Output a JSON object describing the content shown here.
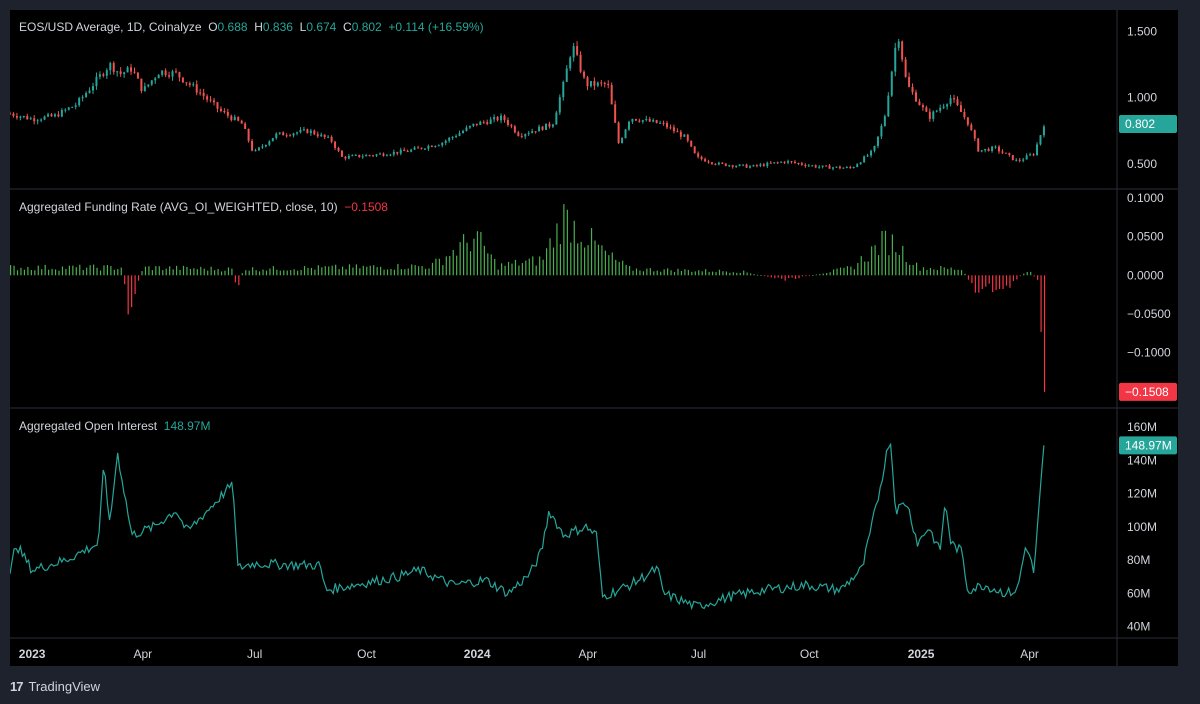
{
  "header": {
    "symbol": "EOS/USD Average, 1D, Coinalyze",
    "o_label": "O",
    "o": "0.688",
    "h_label": "H",
    "h": "0.836",
    "l_label": "L",
    "l": "0.674",
    "c_label": "C",
    "c": "0.802",
    "change": "+0.114 (+16.59%)"
  },
  "funding_header": {
    "title": "Aggregated Funding Rate (AVG_OI_WEIGHTED, close, 10)",
    "value": "−0.1508"
  },
  "oi_header": {
    "title": "Aggregated Open Interest",
    "value": "148.97M"
  },
  "footer": {
    "brand": "TradingView",
    "logo": "17"
  },
  "colors": {
    "up": "#26a69a",
    "down": "#ef5350",
    "funding_up": "#4caf50",
    "funding_down": "#f23645",
    "oi_line": "#26a69a",
    "bg": "#000000",
    "frame": "#1e222d"
  },
  "chart_data": [
    {
      "type": "candlestick",
      "pane": "price",
      "ticks": [
        "1.500",
        "1.000",
        "0.500"
      ],
      "tick_values": [
        1.5,
        1.0,
        0.5
      ],
      "ylim": [
        0.38,
        1.6
      ],
      "last_value_label": "0.802",
      "keypoints": [
        {
          "t": 0.0,
          "v": 0.88
        },
        {
          "t": 0.02,
          "v": 0.84
        },
        {
          "t": 0.04,
          "v": 0.86
        },
        {
          "t": 0.06,
          "v": 0.95
        },
        {
          "t": 0.09,
          "v": 1.25
        },
        {
          "t": 0.1,
          "v": 1.18
        },
        {
          "t": 0.11,
          "v": 1.22
        },
        {
          "t": 0.12,
          "v": 1.05
        },
        {
          "t": 0.135,
          "v": 1.2
        },
        {
          "t": 0.15,
          "v": 1.18
        },
        {
          "t": 0.17,
          "v": 1.05
        },
        {
          "t": 0.19,
          "v": 0.9
        },
        {
          "t": 0.21,
          "v": 0.8
        },
        {
          "t": 0.22,
          "v": 0.58
        },
        {
          "t": 0.24,
          "v": 0.72
        },
        {
          "t": 0.27,
          "v": 0.75
        },
        {
          "t": 0.29,
          "v": 0.68
        },
        {
          "t": 0.3,
          "v": 0.55
        },
        {
          "t": 0.33,
          "v": 0.57
        },
        {
          "t": 0.36,
          "v": 0.6
        },
        {
          "t": 0.39,
          "v": 0.66
        },
        {
          "t": 0.42,
          "v": 0.8
        },
        {
          "t": 0.445,
          "v": 0.85
        },
        {
          "t": 0.46,
          "v": 0.72
        },
        {
          "t": 0.49,
          "v": 0.8
        },
        {
          "t": 0.5,
          "v": 1.1
        },
        {
          "t": 0.508,
          "v": 1.4
        },
        {
          "t": 0.52,
          "v": 1.1
        },
        {
          "t": 0.54,
          "v": 1.1
        },
        {
          "t": 0.55,
          "v": 0.65
        },
        {
          "t": 0.56,
          "v": 0.85
        },
        {
          "t": 0.59,
          "v": 0.8
        },
        {
          "t": 0.61,
          "v": 0.7
        },
        {
          "t": 0.62,
          "v": 0.55
        },
        {
          "t": 0.64,
          "v": 0.5
        },
        {
          "t": 0.67,
          "v": 0.48
        },
        {
          "t": 0.7,
          "v": 0.52
        },
        {
          "t": 0.73,
          "v": 0.48
        },
        {
          "t": 0.76,
          "v": 0.47
        },
        {
          "t": 0.78,
          "v": 0.6
        },
        {
          "t": 0.79,
          "v": 0.85
        },
        {
          "t": 0.802,
          "v": 1.5
        },
        {
          "t": 0.81,
          "v": 1.1
        },
        {
          "t": 0.83,
          "v": 0.85
        },
        {
          "t": 0.85,
          "v": 1.0
        },
        {
          "t": 0.865,
          "v": 0.82
        },
        {
          "t": 0.875,
          "v": 0.6
        },
        {
          "t": 0.89,
          "v": 0.62
        },
        {
          "t": 0.91,
          "v": 0.52
        },
        {
          "t": 0.925,
          "v": 0.58
        },
        {
          "t": 0.93,
          "v": 0.7
        },
        {
          "t": 0.934,
          "v": 0.802
        }
      ]
    },
    {
      "type": "histogram",
      "pane": "funding",
      "ticks": [
        "0.1000",
        "0.0500",
        "0.0000",
        "−0.0500",
        "−0.1000"
      ],
      "tick_values": [
        0.1,
        0.05,
        0.0,
        -0.05,
        -0.1
      ],
      "ylim": [
        -0.16,
        0.1
      ],
      "last_value_label": "−0.1508",
      "keypoints": [
        {
          "t": 0.0,
          "v": 0.01
        },
        {
          "t": 0.1,
          "v": 0.01
        },
        {
          "t": 0.107,
          "v": -0.045
        },
        {
          "t": 0.12,
          "v": 0.01
        },
        {
          "t": 0.2,
          "v": 0.008
        },
        {
          "t": 0.205,
          "v": -0.018
        },
        {
          "t": 0.21,
          "v": 0.008
        },
        {
          "t": 0.38,
          "v": 0.012
        },
        {
          "t": 0.42,
          "v": 0.05
        },
        {
          "t": 0.44,
          "v": 0.012
        },
        {
          "t": 0.48,
          "v": 0.02
        },
        {
          "t": 0.5,
          "v": 0.075
        },
        {
          "t": 0.52,
          "v": 0.05
        },
        {
          "t": 0.54,
          "v": 0.025
        },
        {
          "t": 0.56,
          "v": 0.008
        },
        {
          "t": 0.66,
          "v": 0.005
        },
        {
          "t": 0.7,
          "v": -0.006
        },
        {
          "t": 0.76,
          "v": 0.01
        },
        {
          "t": 0.79,
          "v": 0.045
        },
        {
          "t": 0.8,
          "v": 0.04
        },
        {
          "t": 0.82,
          "v": 0.01
        },
        {
          "t": 0.86,
          "v": 0.008
        },
        {
          "t": 0.87,
          "v": -0.02
        },
        {
          "t": 0.9,
          "v": -0.015
        },
        {
          "t": 0.92,
          "v": 0.008
        },
        {
          "t": 0.928,
          "v": -0.01
        },
        {
          "t": 0.934,
          "v": -0.1508
        }
      ]
    },
    {
      "type": "line",
      "pane": "open_interest",
      "ticks": [
        "160M",
        "140M",
        "120M",
        "100M",
        "80M",
        "60M",
        "40M"
      ],
      "tick_values": [
        160,
        140,
        120,
        100,
        80,
        60,
        40
      ],
      "ylim": [
        38,
        166
      ],
      "unit": "M",
      "last_value_label": "148.97M",
      "keypoints": [
        {
          "t": 0.0,
          "v": 70
        },
        {
          "t": 0.005,
          "v": 90
        },
        {
          "t": 0.02,
          "v": 74
        },
        {
          "t": 0.05,
          "v": 80
        },
        {
          "t": 0.08,
          "v": 90
        },
        {
          "t": 0.085,
          "v": 140
        },
        {
          "t": 0.09,
          "v": 100
        },
        {
          "t": 0.097,
          "v": 145
        },
        {
          "t": 0.11,
          "v": 95
        },
        {
          "t": 0.13,
          "v": 100
        },
        {
          "t": 0.15,
          "v": 110
        },
        {
          "t": 0.16,
          "v": 97
        },
        {
          "t": 0.19,
          "v": 118
        },
        {
          "t": 0.2,
          "v": 125
        },
        {
          "t": 0.203,
          "v": 115
        },
        {
          "t": 0.205,
          "v": 75
        },
        {
          "t": 0.22,
          "v": 78
        },
        {
          "t": 0.26,
          "v": 77
        },
        {
          "t": 0.28,
          "v": 77
        },
        {
          "t": 0.285,
          "v": 62
        },
        {
          "t": 0.31,
          "v": 65
        },
        {
          "t": 0.35,
          "v": 70
        },
        {
          "t": 0.37,
          "v": 74
        },
        {
          "t": 0.4,
          "v": 65
        },
        {
          "t": 0.43,
          "v": 68
        },
        {
          "t": 0.45,
          "v": 60
        },
        {
          "t": 0.47,
          "v": 72
        },
        {
          "t": 0.48,
          "v": 85
        },
        {
          "t": 0.487,
          "v": 110
        },
        {
          "t": 0.5,
          "v": 95
        },
        {
          "t": 0.52,
          "v": 100
        },
        {
          "t": 0.53,
          "v": 95
        },
        {
          "t": 0.535,
          "v": 58
        },
        {
          "t": 0.56,
          "v": 65
        },
        {
          "t": 0.585,
          "v": 75
        },
        {
          "t": 0.59,
          "v": 60
        },
        {
          "t": 0.62,
          "v": 52
        },
        {
          "t": 0.65,
          "v": 58
        },
        {
          "t": 0.68,
          "v": 62
        },
        {
          "t": 0.72,
          "v": 65
        },
        {
          "t": 0.75,
          "v": 62
        },
        {
          "t": 0.77,
          "v": 75
        },
        {
          "t": 0.785,
          "v": 120
        },
        {
          "t": 0.795,
          "v": 155
        },
        {
          "t": 0.8,
          "v": 110
        },
        {
          "t": 0.81,
          "v": 115
        },
        {
          "t": 0.82,
          "v": 90
        },
        {
          "t": 0.83,
          "v": 100
        },
        {
          "t": 0.84,
          "v": 85
        },
        {
          "t": 0.845,
          "v": 115
        },
        {
          "t": 0.85,
          "v": 90
        },
        {
          "t": 0.86,
          "v": 85
        },
        {
          "t": 0.865,
          "v": 62
        },
        {
          "t": 0.88,
          "v": 65
        },
        {
          "t": 0.9,
          "v": 60
        },
        {
          "t": 0.91,
          "v": 62
        },
        {
          "t": 0.918,
          "v": 90
        },
        {
          "t": 0.925,
          "v": 72
        },
        {
          "t": 0.934,
          "v": 148.97
        }
      ]
    }
  ],
  "x_axis": {
    "labels": [
      {
        "text": "2023",
        "t": 0.02,
        "bold": true
      },
      {
        "text": "Apr",
        "t": 0.12,
        "bold": false
      },
      {
        "text": "Jul",
        "t": 0.221,
        "bold": false
      },
      {
        "text": "Oct",
        "t": 0.322,
        "bold": false
      },
      {
        "text": "2024",
        "t": 0.422,
        "bold": true
      },
      {
        "text": "Apr",
        "t": 0.522,
        "bold": false
      },
      {
        "text": "Jul",
        "t": 0.622,
        "bold": false
      },
      {
        "text": "Oct",
        "t": 0.722,
        "bold": false
      },
      {
        "text": "2025",
        "t": 0.823,
        "bold": true
      },
      {
        "text": "Apr",
        "t": 0.921,
        "bold": false
      }
    ]
  }
}
